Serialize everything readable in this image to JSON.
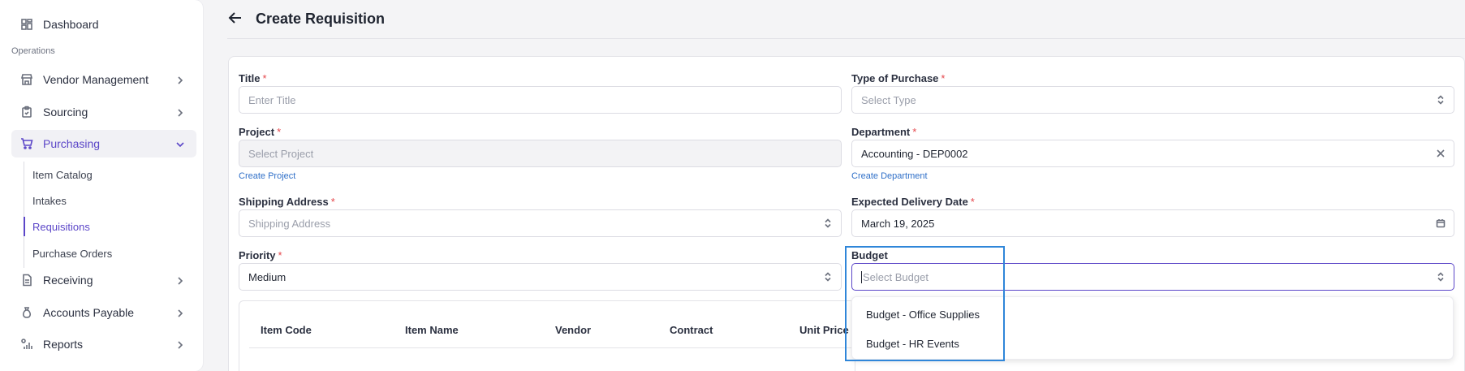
{
  "sidebar": {
    "dashboard": "Dashboard",
    "section_label": "Operations",
    "items": {
      "vendor_management": "Vendor Management",
      "sourcing": "Sourcing",
      "purchasing": "Purchasing",
      "receiving": "Receiving",
      "accounts_payable": "Accounts Payable",
      "reports": "Reports"
    },
    "purchasing_sub": {
      "item_catalog": "Item Catalog",
      "intakes": "Intakes",
      "requisitions": "Requisitions",
      "purchase_orders": "Purchase Orders"
    },
    "accent_color": "#5b46c8"
  },
  "header": {
    "title": "Create Requisition"
  },
  "form": {
    "title": {
      "label": "Title",
      "placeholder": "Enter Title"
    },
    "type_of_purchase": {
      "label": "Type of Purchase",
      "placeholder": "Select Type"
    },
    "project": {
      "label": "Project",
      "placeholder": "Select Project",
      "link": "Create Project"
    },
    "department": {
      "label": "Department",
      "value": "Accounting - DEP0002",
      "link": "Create Department"
    },
    "shipping_address": {
      "label": "Shipping Address",
      "placeholder": "Shipping Address"
    },
    "expected_delivery_date": {
      "label": "Expected Delivery Date",
      "value": "March 19, 2025"
    },
    "priority": {
      "label": "Priority",
      "value": "Medium"
    },
    "budget": {
      "label": "Budget",
      "placeholder": "Select Budget"
    },
    "required_marker": "*"
  },
  "table": {
    "columns": [
      "Item Code",
      "Item Name",
      "Vendor",
      "Contract",
      "Unit Price"
    ]
  },
  "budget_dropdown": {
    "options": [
      "Budget - Office Supplies",
      "Budget - HR Events"
    ]
  },
  "colors": {
    "required": "#e5484d",
    "link": "#2f6fc8",
    "highlight": "#2f86d9"
  }
}
